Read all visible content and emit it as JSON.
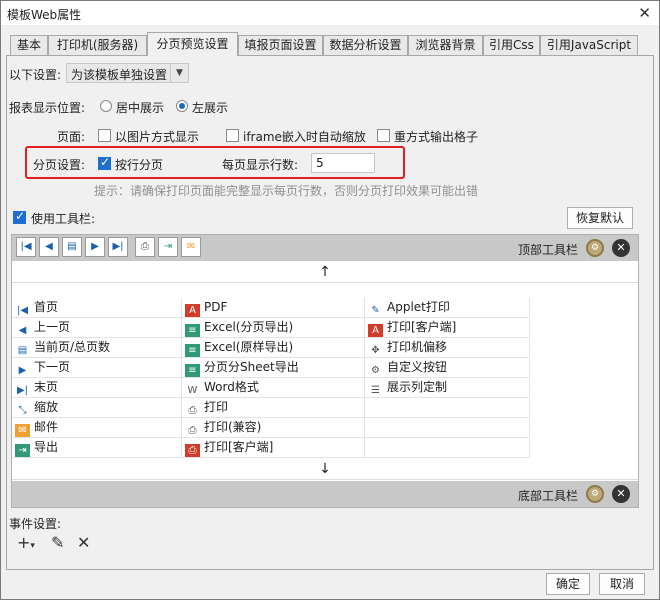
{
  "window": {
    "title": "模板Web属性"
  },
  "tabs": [
    {
      "label": "基本"
    },
    {
      "label": "打印机(服务器)"
    },
    {
      "label": "分页预览设置"
    },
    {
      "label": "填报页面设置"
    },
    {
      "label": "数据分析设置"
    },
    {
      "label": "浏览器背景"
    },
    {
      "label": "引用Css"
    },
    {
      "label": "引用JavaScript"
    }
  ],
  "settings": {
    "apply_label": "以下设置:",
    "apply_value": "为该模板单独设置",
    "position_label": "报表显示位置:",
    "position_center": "居中展示",
    "position_left": "左展示",
    "page_label": "页面:",
    "opt_image": "以图片方式显示",
    "opt_iframe": "iframe嵌入时自动缩放",
    "opt_grid": "重方式输出格子",
    "paging_label": "分页设置:",
    "paging_by_row": "按行分页",
    "rows_label": "每页显示行数:",
    "rows_value": "5",
    "hint": "提示：请确保打印页面能完整显示每页行数，否则分页打印效果可能出错"
  },
  "toolbar": {
    "use_label": "使用工具栏:",
    "restore_button": "恢复默认",
    "top_label": "顶部工具栏",
    "bottom_label": "底部工具栏",
    "up_arrow": "↑",
    "down_arrow": "↓",
    "col1": [
      {
        "label": "首页",
        "icon": "first-page-icon"
      },
      {
        "label": "上一页",
        "icon": "previous-page-icon"
      },
      {
        "label": "当前页/总页数",
        "icon": "page-count-icon"
      },
      {
        "label": "下一页",
        "icon": "next-page-icon"
      },
      {
        "label": "末页",
        "icon": "last-page-icon"
      },
      {
        "label": "缩放",
        "icon": "zoom-icon"
      },
      {
        "label": "邮件",
        "icon": "mail-icon"
      },
      {
        "label": "导出",
        "icon": "export-icon"
      }
    ],
    "col2": [
      {
        "label": "PDF",
        "icon": "pdf-icon"
      },
      {
        "label": "Excel(分页导出)",
        "icon": "excel-icon"
      },
      {
        "label": "Excel(原样导出)",
        "icon": "excel-icon"
      },
      {
        "label": "分页分Sheet导出",
        "icon": "excel-icon"
      },
      {
        "label": "Word格式",
        "icon": "word-icon"
      },
      {
        "label": "打印",
        "icon": "print-icon"
      },
      {
        "label": "打印(兼容)",
        "icon": "print-icon"
      },
      {
        "label": "打印[客户端]",
        "icon": "print-client-icon"
      }
    ],
    "col3": [
      {
        "label": "Applet打印",
        "icon": "applet-icon"
      },
      {
        "label": "打印[客户端]",
        "icon": "pdf-icon"
      },
      {
        "label": "打印机偏移",
        "icon": "move-icon"
      },
      {
        "label": "自定义按钮",
        "icon": "gear-icon"
      },
      {
        "label": "展示列定制",
        "icon": "list-icon"
      }
    ]
  },
  "events": {
    "label": "事件设置:"
  },
  "footer": {
    "ok_button": "确定",
    "cancel_button": "取消"
  }
}
